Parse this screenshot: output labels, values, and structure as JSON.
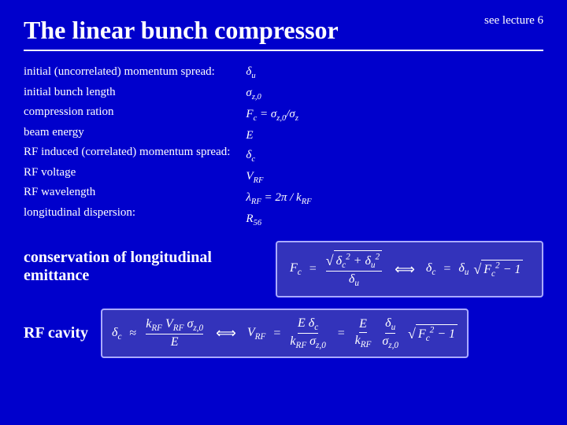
{
  "slide": {
    "top_right_label": "see lecture 6",
    "title": "The linear bunch compressor",
    "labels": [
      "initial (uncorrelated) momentum spread:",
      "initial bunch length",
      "compression ration",
      "beam energy",
      "RF induced (correlated) momentum spread:",
      "RF voltage",
      "RF wavelength",
      "longitudinal dispersion:"
    ],
    "symbols": [
      "δ_u",
      "σ_z,0",
      "F_c = σ_z,0 / σ_z",
      "E",
      "δ_c",
      "V_RF",
      "λ_RF = 2π / k_RF",
      "R_56"
    ],
    "conservation_label": "conservation of longitudinal emittance",
    "rf_cavity_label": "RF cavity"
  }
}
